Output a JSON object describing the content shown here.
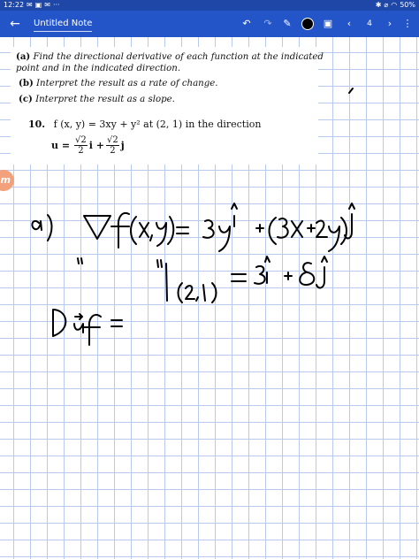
{
  "status_bar": {
    "time": "12:22",
    "notifications": [
      "✉",
      "▣",
      "✉",
      "···"
    ],
    "battery": "50%"
  },
  "toolbar": {
    "back_icon": "←",
    "title": "Untitled Note",
    "undo_icon": "↶",
    "redo_icon": "↷",
    "pen_icon": "✎",
    "image_icon": "▣",
    "prev_icon": "‹",
    "page_number": "4",
    "next_icon": "›",
    "menu_icon": "⋮"
  },
  "excerpt": {
    "line_a_label": "(a)",
    "line_a": "Find the directional derivative of each function at the indicated",
    "line_a2": "point and in the indicated direction.",
    "line_b_label": "(b)",
    "line_b": "Interpret the result as a rate of change.",
    "line_c_label": "(c)",
    "line_c": "Interpret the result as a slope.",
    "problem_number": "10.",
    "problem_text": "f (x, y) = 3xy + y² at (2, 1) in the direction",
    "direction_u": "u =",
    "frac_num": "√2",
    "frac_den": "2",
    "i_term": "i +",
    "j_term": "j"
  },
  "handwriting": {
    "line1_label": "a)",
    "line1": "∇f(x, y) = 3y î + (3x + 2y) ĵ",
    "line2_ditto": "\"",
    "line2": "\"|(2,1) = 3î + 8ĵ",
    "line3": "D_u f ="
  },
  "badge": "m",
  "colors": {
    "status_bar": "#1f47a8",
    "toolbar": "#2355c9",
    "grid": "#b8cbef",
    "ink": "#000000",
    "badge": "#f3a07c"
  }
}
